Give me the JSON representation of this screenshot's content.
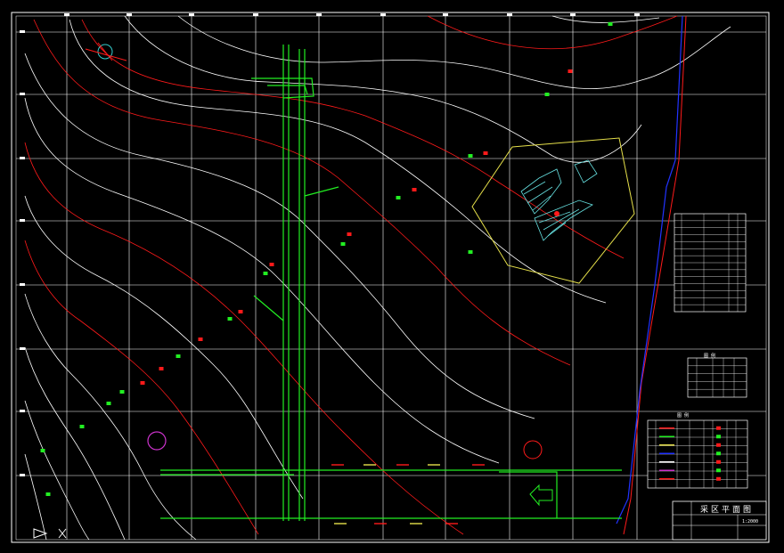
{
  "drawing": {
    "title": "采区平面图",
    "scale": "1:2000",
    "colors": {
      "background": "#000000",
      "border": "#ffffff",
      "grid": "#ffffff",
      "contour_white": "#ffffff",
      "contour_red": "#ff1a1a",
      "roadway": "#22ee22",
      "boundary_blue": "#2233ff",
      "polygon_yellow": "#e6e04a",
      "hatch_cyan": "#66e0e0",
      "circle_magenta": "#cc33cc"
    },
    "icons": [
      "north-arrow-icon",
      "ventilation-arrow-icon",
      "drawing-direction-icon"
    ]
  },
  "legend_small": {
    "title": "图 例"
  },
  "legend_main": {
    "title": "图 例"
  },
  "title_block": {
    "title": "采区平面图",
    "scale": "1:2000"
  }
}
